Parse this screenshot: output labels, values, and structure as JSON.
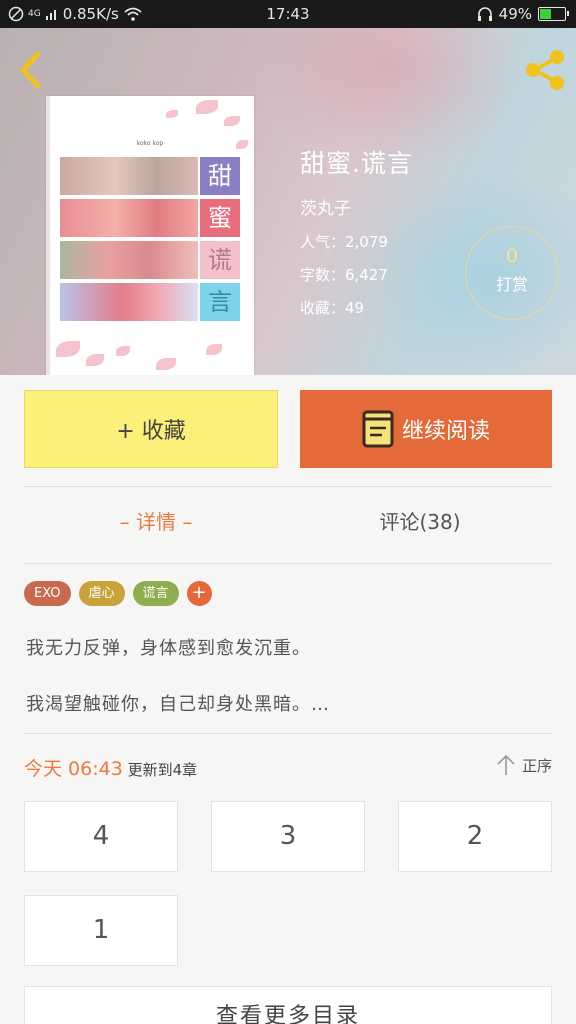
{
  "status_bar": {
    "network": "4G",
    "speed": "0.85K/s",
    "time": "17:43",
    "battery": "49%",
    "battery_level": 0.49
  },
  "header": {
    "back_icon": "chevron-left-icon",
    "share_icon": "share-icon",
    "accent_color": "#f0c31c"
  },
  "cover": {
    "caption": "koko kop",
    "glyphs": [
      "甜",
      "蜜",
      "谎",
      "言"
    ]
  },
  "book": {
    "title": "甜蜜.谎言",
    "author": "茨丸子",
    "popularity": "人气：2,079",
    "word_count": "字数：6,427",
    "favorites": "收藏：49"
  },
  "tip": {
    "count": "0",
    "label": "打赏"
  },
  "actions": {
    "collect": "+ 收藏",
    "read": "继续阅读",
    "collect_color": "#fbf07a",
    "read_color": "#e56a39"
  },
  "tabs": {
    "details": "– 详情 –",
    "comments": "评论(38)"
  },
  "tags": [
    {
      "label": "EXO",
      "color": "#c96a50"
    },
    {
      "label": "虐心",
      "color": "#c9a23c"
    },
    {
      "label": "谎言",
      "color": "#8dae4e"
    }
  ],
  "tag_add": {
    "label": "+",
    "color": "#e6683a"
  },
  "description": {
    "line1": "我无力反弹，身体感到愈发沉重。",
    "line2": "我渴望触碰你，自己却身处黑暗。…"
  },
  "update": {
    "time": "今天 06:43",
    "text": "更新到4章",
    "sort_label": "正序"
  },
  "chapters": [
    "4",
    "3",
    "2",
    "1"
  ],
  "catalog_button": "查看更多目录"
}
